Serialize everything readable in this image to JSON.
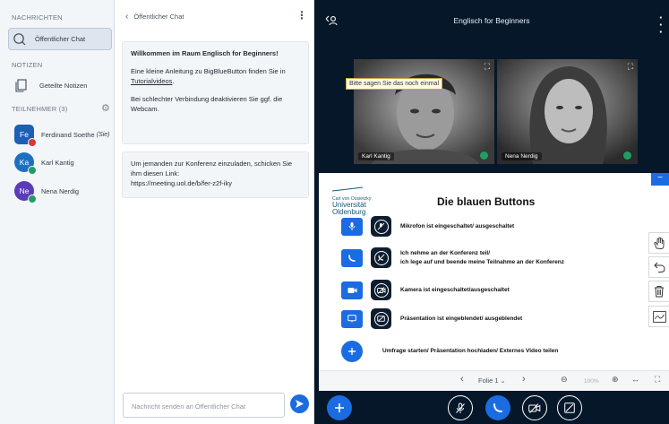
{
  "sidebar": {
    "messages_label": "NACHRICHTEN",
    "public_chat": "Öffentlicher Chat",
    "notes_label": "NOTIZEN",
    "shared_notes": "Geteilte Notizen",
    "users_label": "TEILNEHMER (3)",
    "users": [
      {
        "initials": "Fe",
        "name": "Ferdinand Soethe",
        "suffix": "(Sie)",
        "color": "#1d5fb5"
      },
      {
        "initials": "Ka",
        "name": "Karl Kantig",
        "suffix": "",
        "color": "#1f6fc0"
      },
      {
        "initials": "Ne",
        "name": "Nena Nerdig",
        "suffix": "",
        "color": "#5a3bb8"
      }
    ]
  },
  "chat": {
    "title": "Öffentlicher Chat",
    "welcome_prefix": "Willkommen im Raum ",
    "welcome_room": "Englisch for Beginners",
    "welcome_suffix": "!",
    "guide_text": "Eine kleine Anleitung zu BigBlueButton finden Sie in ",
    "guide_link": "Tutorialvideos",
    "guide_end": ".",
    "webcam_text": "Bei schlechter Verbindung deaktivieren Sie ggf. die Webcam.",
    "invite_text": "Um jemanden zur Konferenz einzuladen, schicken Sie ihm diesen Link:",
    "invite_link": "https://meeting.uol.de/b/fer-z2f-iky",
    "input_placeholder": "Nachricht senden an Öffentlicher Chat"
  },
  "main": {
    "title": "Englisch for Beginners",
    "tooltip": "Bitte sagen Sie das noch einmal",
    "videos": [
      {
        "name": "Karl Kantig"
      },
      {
        "name": "Nena Nerdig"
      }
    ]
  },
  "slide": {
    "logo_small": "Carl von Ossietzky",
    "logo_line1": "Universität",
    "logo_line2": "Oldenburg",
    "title": "Die blauen Buttons",
    "rows": [
      {
        "text1": "Mikrofon ist eingeschaltet/ ausgeschaltet",
        "text2": ""
      },
      {
        "text1": "Ich nehme an der Konferenz teil/",
        "text2": "ich lege auf und beende meine Teilnahme an der Konferenz"
      },
      {
        "text1": "Kamera ist eingeschaltet/ausgeschaltet",
        "text2": ""
      },
      {
        "text1": "Präsentation ist eingeblendet/  ausgeblendet",
        "text2": ""
      },
      {
        "text1": "Umfrage starten/ Präsentation hochladen/ Externes Video teilen",
        "text2": ""
      }
    ]
  },
  "pres_nav": {
    "slide_label": "Folie 1",
    "zoom": "100%"
  },
  "colors": {
    "accent": "#1b6ce0",
    "dark_bg": "#06172a"
  }
}
